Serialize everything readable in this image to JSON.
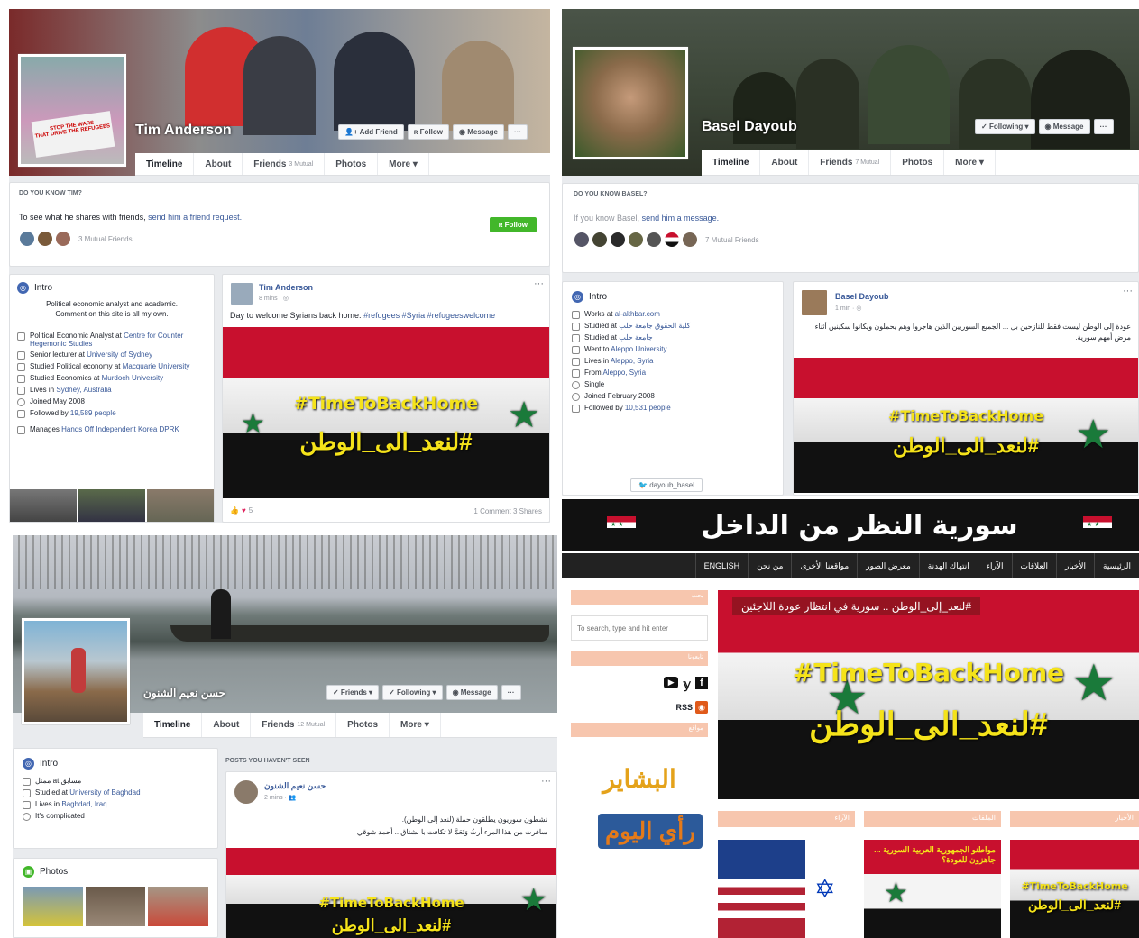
{
  "tim": {
    "name": "Tim Anderson",
    "buttons": {
      "add_friend": "Add Friend",
      "follow": "Follow",
      "message": "Message",
      "more": "···"
    },
    "tabs": {
      "timeline": "Timeline",
      "about": "About",
      "friends": "Friends",
      "friends_count": "3 Mutual",
      "photos": "Photos",
      "more": "More ▾"
    },
    "know_caption": "DO YOU KNOW TIM?",
    "know_text": "To see what he shares with friends,",
    "know_link": "send him a friend request.",
    "follow_btn": "Follow",
    "mutual": "3 Mutual Friends",
    "intro": {
      "title": "Intro",
      "bio1": "Political economic analyst and academic.",
      "bio2": "Comment on this site is all my own.",
      "l1a": "Political Economic Analyst at",
      "l1b": "Centre for Counter Hegemonic Studies",
      "l2a": "Senior lecturer at",
      "l2b": "University of Sydney",
      "l3a": "Studied Political economy at",
      "l3b": "Macquarie University",
      "l4a": "Studied Economics at",
      "l4b": "Murdoch University",
      "l5a": "Lives in",
      "l5b": "Sydney, Australia",
      "l6": "Joined May 2008",
      "l7a": "Followed by",
      "l7b": "19,589 people",
      "l8a": "Manages",
      "l8b": "Hands Off Independent Korea DPRK"
    },
    "post": {
      "author": "Tim Anderson",
      "time": "8 mins · ",
      "text": "Day to welcome Syrians back home.",
      "tags": "#refugees #Syria #refugeeswelcome",
      "reactions": "5",
      "stats": "1 Comment  3 Shares"
    },
    "cover_sign1": "STOP THE WARS",
    "cover_sign2": "THAT DRIVE THE REFUGEES"
  },
  "basel": {
    "name": "Basel Dayoub",
    "buttons": {
      "following": "Following ▾",
      "message": "Message",
      "more": "···"
    },
    "tabs": {
      "timeline": "Timeline",
      "about": "About",
      "friends": "Friends",
      "friends_count": "7 Mutual",
      "photos": "Photos",
      "more": "More ▾"
    },
    "know_caption": "DO YOU KNOW BASEL?",
    "know_text": "If you know Basel,",
    "know_link": "send him a message.",
    "mutual": "7 Mutual Friends",
    "intro": {
      "title": "Intro",
      "l1a": "Works at",
      "l1b": "al-akhbar.com",
      "l2a": "Studied at",
      "l2b": "كلية الحقوق جامعة حلب",
      "l3a": "Studied at",
      "l3b": "جامعة حلب",
      "l4a": "Went to",
      "l4b": "Aleppo University",
      "l5a": "Lives in",
      "l5b": "Aleppo, Syria",
      "l6a": "From",
      "l6b": "Aleppo, Syria",
      "l7": "Single",
      "l8": "Joined February 2008",
      "l9a": "Followed by",
      "l9b": "10,531 people",
      "twitter": "dayoub_basel"
    },
    "post": {
      "author": "Basel Dayoub",
      "time": "1 min · ",
      "text": "عودة إلى الوطن ليست فقط للنازحين بل ... الجميع السوريين الذين هاجروا وهم يحملون ويكانوا سكينين أثناء مرض أمهم سورية."
    }
  },
  "hassan": {
    "name": "حسن نعيم الشنون",
    "buttons": {
      "friends": "✓ Friends ▾",
      "following": "✓ Following ▾",
      "message": "Message",
      "more": "···"
    },
    "tabs": {
      "timeline": "Timeline",
      "about": "About",
      "friends": "Friends",
      "friends_count": "12 Mutual",
      "photos": "Photos",
      "more": "More ▾"
    },
    "intro": {
      "title": "Intro",
      "l1": "ممثل at مسابق",
      "l2a": "Studied at",
      "l2b": "University of Baghdad",
      "l3a": "Lives in",
      "l3b": "Baghdad, Iraq",
      "l4": "It's complicated"
    },
    "photos_title": "Photos",
    "posts_caption": "POSTS YOU HAVEN'T SEEN",
    "post": {
      "author": "حسن نعيم الشنون",
      "time": "2 mins · ",
      "text1": "نشطون سوريون يطلقون حملة (لنعد إلى الوطن).",
      "text2": "سافرت من هذا المرء أرثُ وَتَعَمَّ لا تكافت با بشتاق .. أحمد شوقي"
    }
  },
  "site": {
    "logo_text": "سورية النظر من الداخل",
    "nav": [
      "الرئيسية",
      "الأخبار",
      "العلاقات",
      "الآراء",
      "انتهاك الهدنة",
      "معرض الصور",
      "مواقعنا الأخرى",
      "من نحن",
      "ENGLISH"
    ],
    "sidebar_h1": "بحث",
    "search_placeholder": "To search, type and hit enter",
    "sidebar_h2": "تابعونا",
    "rss": "RSS",
    "sidebar_h3": "مواقع",
    "partner1": "البشاير",
    "partner2": "رأي اليوم",
    "headline": "#لنعد_إلى_الوطن .. سورية في انتظار عودة اللاجئين",
    "cat1": "الآراء",
    "cat2": "الملفات",
    "cat3": "الأخبار",
    "thumb_text": "مواطنو الجمهورية العربية السورية ... جاهزون للعودة؟"
  },
  "campaign": {
    "en": "#TimeToBackHome",
    "ar": "#لنعد_الى_الوطن"
  },
  "colors": {
    "fb_blue": "#385898",
    "fb_green": "#42b72a",
    "flag_red": "#c8102e",
    "flag_green": "#1a7a3a",
    "banner_yellow": "#f5e31a",
    "site_peach": "#f7c6ae"
  }
}
